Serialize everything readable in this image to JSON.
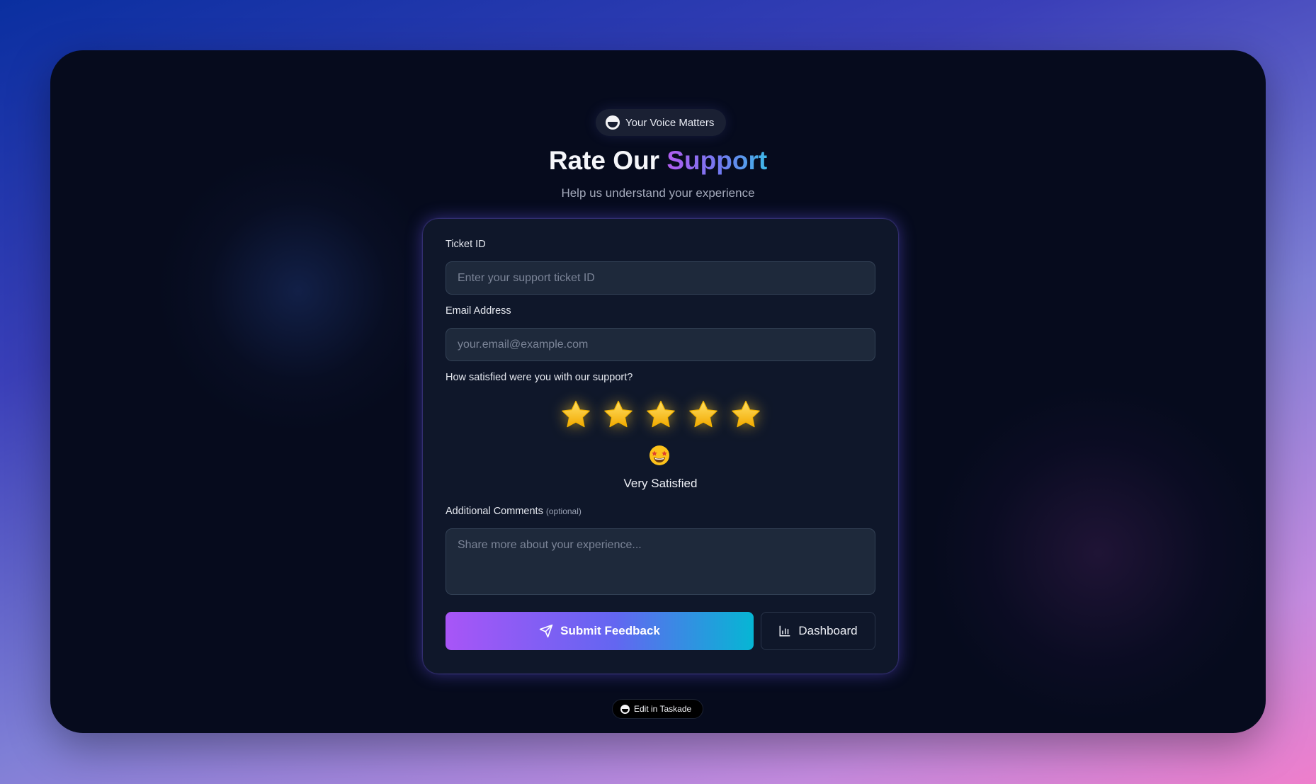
{
  "badge": {
    "label": "Your Voice Matters",
    "icon": "taskade-icon"
  },
  "header": {
    "title_plain": "Rate Our ",
    "title_accent": "Support",
    "subtitle": "Help us understand your experience"
  },
  "form": {
    "ticket": {
      "label": "Ticket ID",
      "placeholder": "Enter your support ticket ID",
      "value": ""
    },
    "email": {
      "label": "Email Address",
      "placeholder": "your.email@example.com",
      "value": ""
    },
    "rating": {
      "question": "How satisfied were you with our support?",
      "value": 5,
      "max": 5,
      "emoji": "star-struck-emoji",
      "text": "Very Satisfied",
      "star_color": "#f5c518"
    },
    "comments": {
      "label": "Additional Comments",
      "optional_note": "(optional)",
      "placeholder": "Share more about your experience...",
      "value": ""
    }
  },
  "actions": {
    "submit_label": "Submit Feedback",
    "submit_icon": "send-icon",
    "dashboard_label": "Dashboard",
    "dashboard_icon": "bar-chart-icon"
  },
  "footer": {
    "edit_label": "Edit in Taskade",
    "icon": "taskade-icon"
  },
  "colors": {
    "accent_start": "#a855f7",
    "accent_mid": "#6366f1",
    "accent_end": "#06b6d4",
    "card_bg": "#0f172a",
    "window_bg": "#060b1d"
  }
}
